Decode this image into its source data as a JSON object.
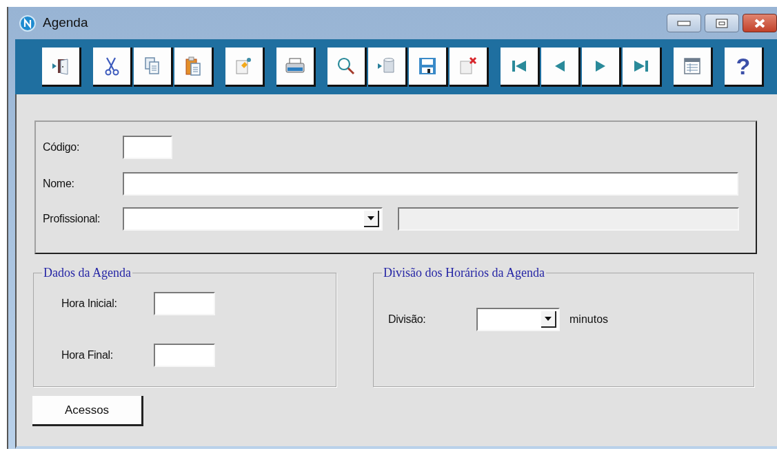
{
  "window": {
    "title": "Agenda"
  },
  "toolbar": {
    "help_label": "?"
  },
  "form": {
    "codigo_label": "Código:",
    "nome_label": "Nome:",
    "profissional_label": "Profissional:"
  },
  "dados_agenda": {
    "title": "Dados da Agenda",
    "hora_inicial_label": "Hora Inicial:",
    "hora_final_label": "Hora Final:"
  },
  "divisao_horarios": {
    "title": "Divisão dos Horários da Agenda",
    "divisao_label": "Divisão:",
    "unit": "minutos"
  },
  "buttons": [
    "Acessos"
  ]
}
